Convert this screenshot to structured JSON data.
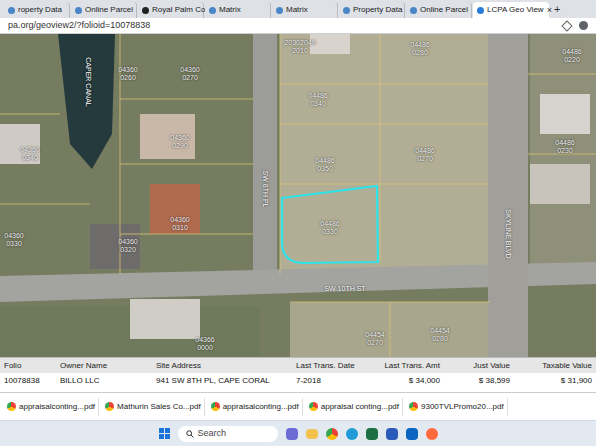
{
  "browser": {
    "tabs": [
      {
        "label": "roperty Data",
        "selected": false
      },
      {
        "label": "Online Parcel",
        "selected": false
      },
      {
        "label": "Royal Palm Co",
        "selected": false
      },
      {
        "label": "Matrix",
        "selected": false
      },
      {
        "label": "Matrix",
        "selected": false
      },
      {
        "label": "Property Data",
        "selected": false
      },
      {
        "label": "Online Parcel",
        "selected": false
      },
      {
        "label": "LCPA Geo View",
        "selected": true
      }
    ],
    "close": "×",
    "new_tab": "+",
    "address": "pa.org/geoview2/?folioid=10078838"
  },
  "map": {
    "labels": [
      "04360\n0260",
      "04360\n0270",
      "04360\n0290",
      "04360\n0310",
      "04360\n0320",
      "04360\n0340",
      "04360\n0330",
      "20302049\n2010",
      "04486\n0280",
      "04486\n0340",
      "04486\n0350",
      "04486\n0270",
      "04486\n0330",
      "04486\n0220",
      "04486\n0230",
      "04454\n0280",
      "04454\n0270",
      "04366\n0000"
    ],
    "streets": [
      "CAPER CANAL",
      "SW 8TH PL",
      "SW 10TH ST",
      "SKYLINE BLVD"
    ]
  },
  "table": {
    "columns": [
      "Folio",
      "Owner Name",
      "Site Address",
      "Last Trans. Date",
      "Last Trans. Amt",
      "Just Value",
      "Taxable Value"
    ],
    "rows": [
      [
        "10078838",
        "BILLO LLC",
        "941 SW 8TH PL, CAPE CORAL",
        "7-2018",
        "$ 34,000",
        "$ 38,599",
        "$ 31,900"
      ]
    ]
  },
  "downloads": [
    "appraisalconting...pdf",
    "Mathurin Sales Co...pdf",
    "appraisalconting...pdf",
    "appraisal conting...pdf",
    "9300TVLPromo20...pdf"
  ],
  "taskbar": {
    "search": "Search"
  }
}
